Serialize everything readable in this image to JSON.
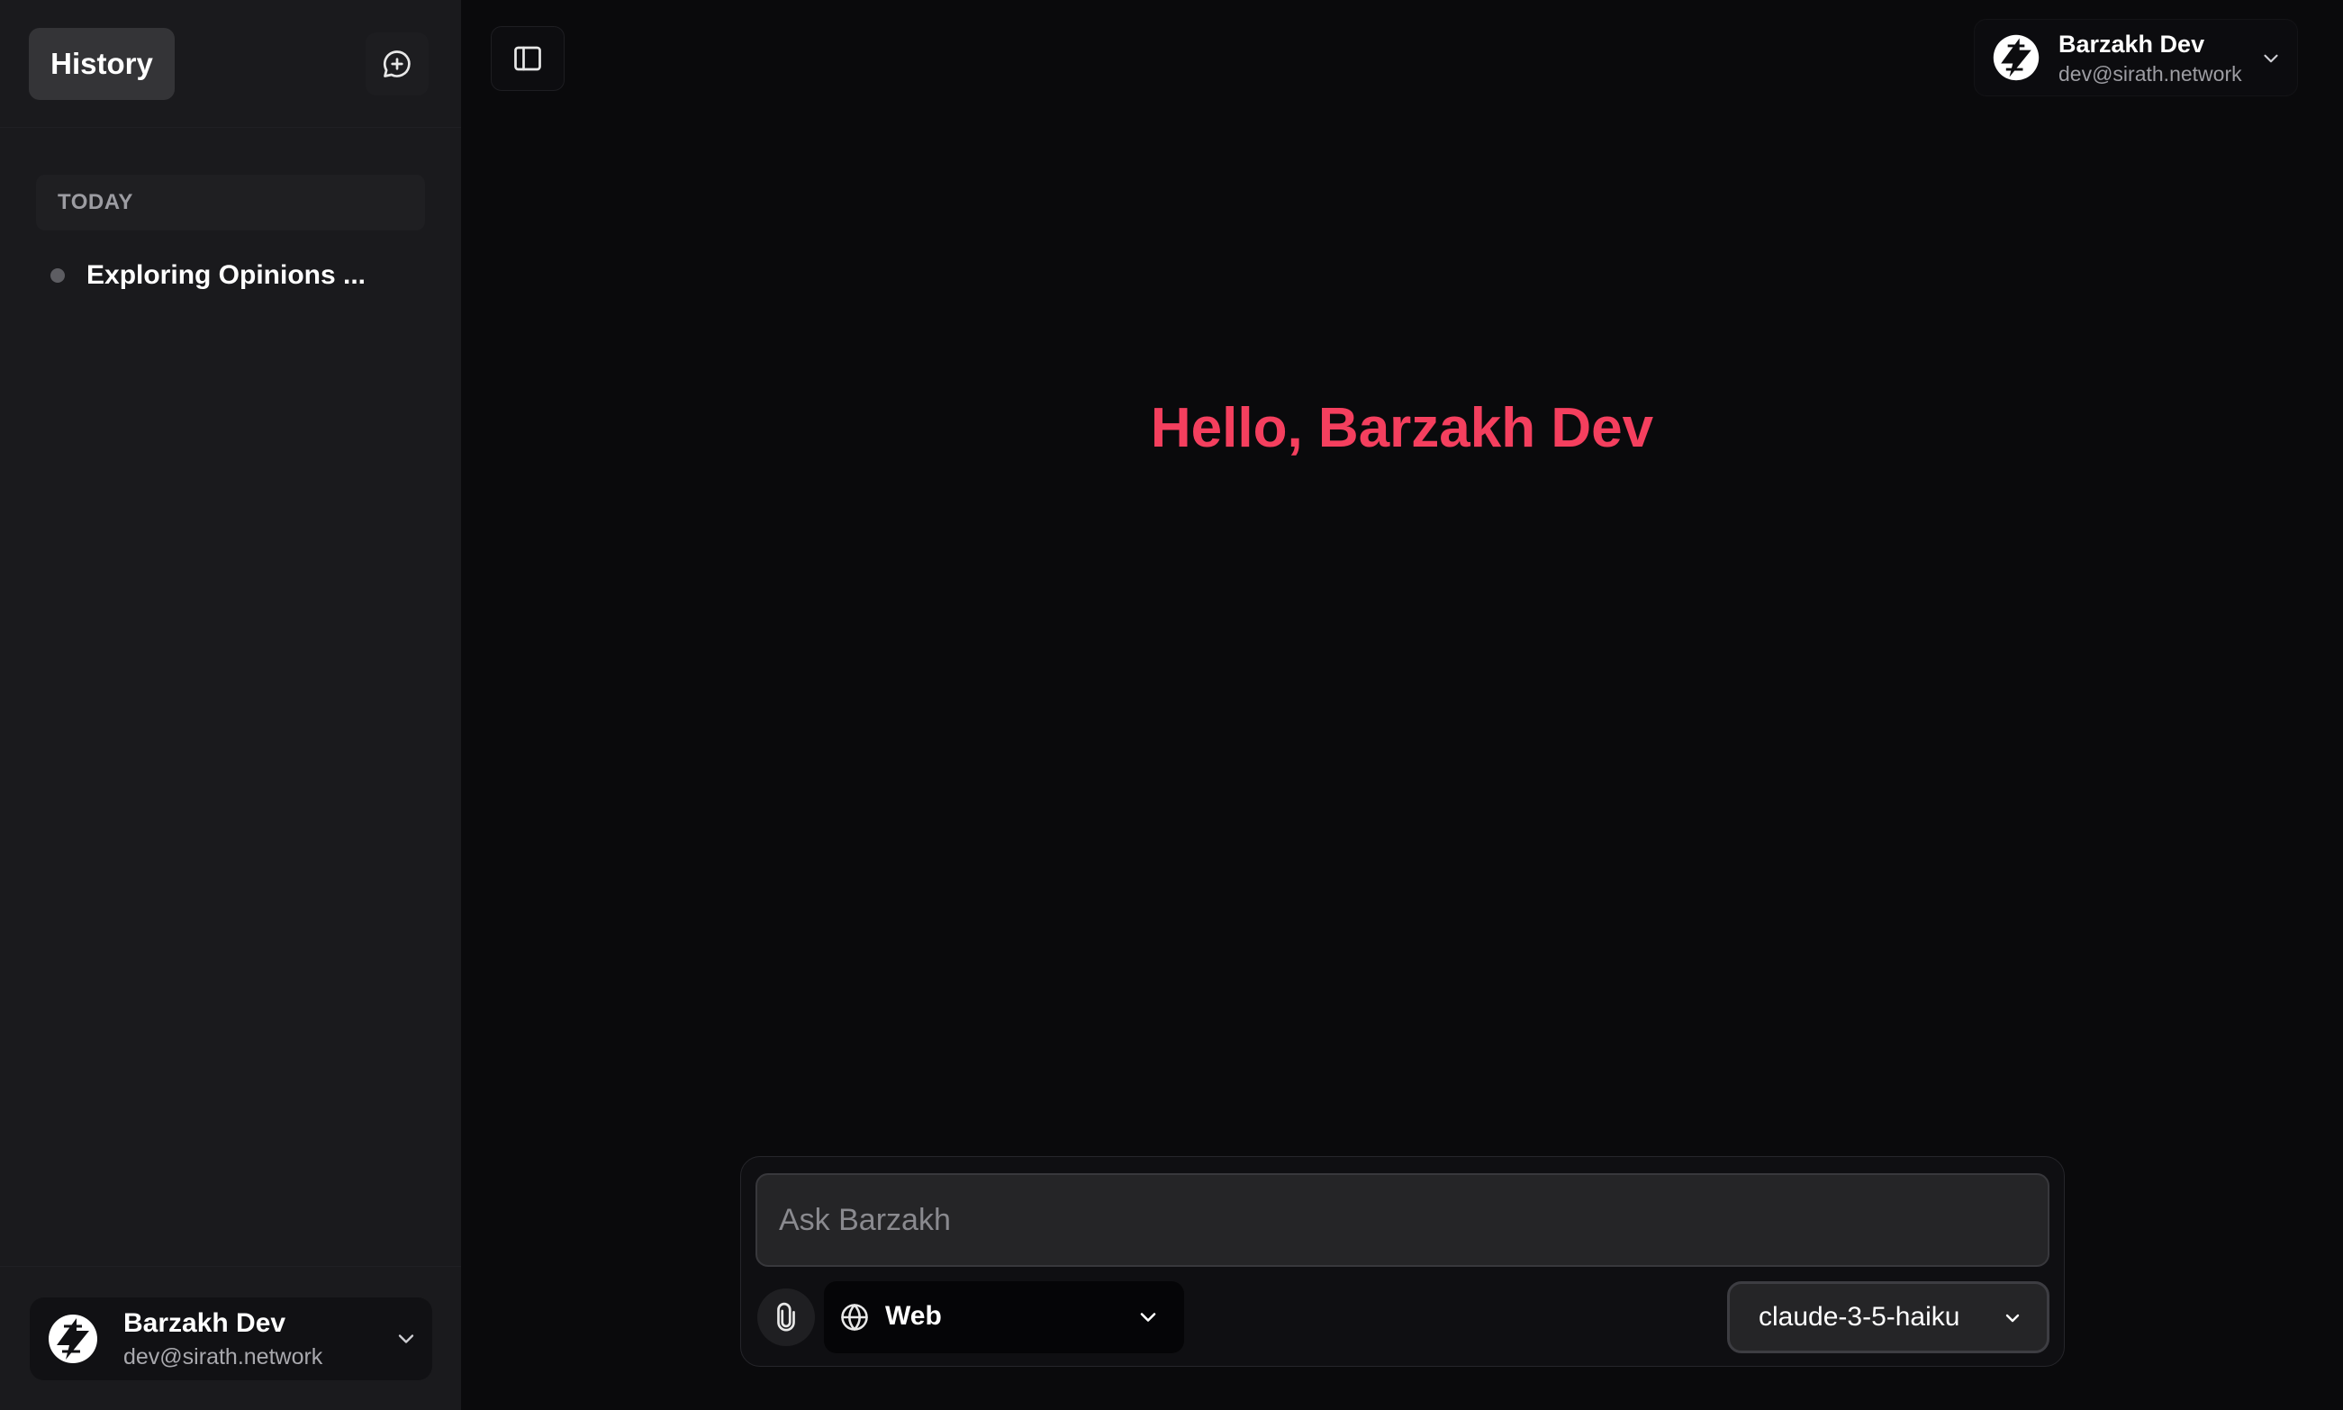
{
  "sidebar": {
    "history_label": "History",
    "section_label": "TODAY",
    "items": [
      {
        "title": "Exploring Opinions ..."
      }
    ],
    "user": {
      "name": "Barzakh Dev",
      "email": "dev@sirath.network"
    }
  },
  "header": {
    "user": {
      "name": "Barzakh Dev",
      "email": "dev@sirath.network"
    }
  },
  "main": {
    "greeting": "Hello, Barzakh Dev"
  },
  "composer": {
    "placeholder": "Ask Barzakh",
    "value": "",
    "source_label": "Web",
    "model_label": "claude-3-5-haiku"
  },
  "icons": {
    "new_chat": "message-plus-icon",
    "toggle_sidebar": "sidebar-toggle-icon",
    "attach": "paperclip-icon",
    "source": "globe-icon",
    "avatar": "logo-slash-icon",
    "dropdown": "chevron-down-icon"
  },
  "colors": {
    "accent": "#f43f5e",
    "sidebar_bg": "#1a1a1d",
    "main_bg": "#0a0a0c"
  }
}
